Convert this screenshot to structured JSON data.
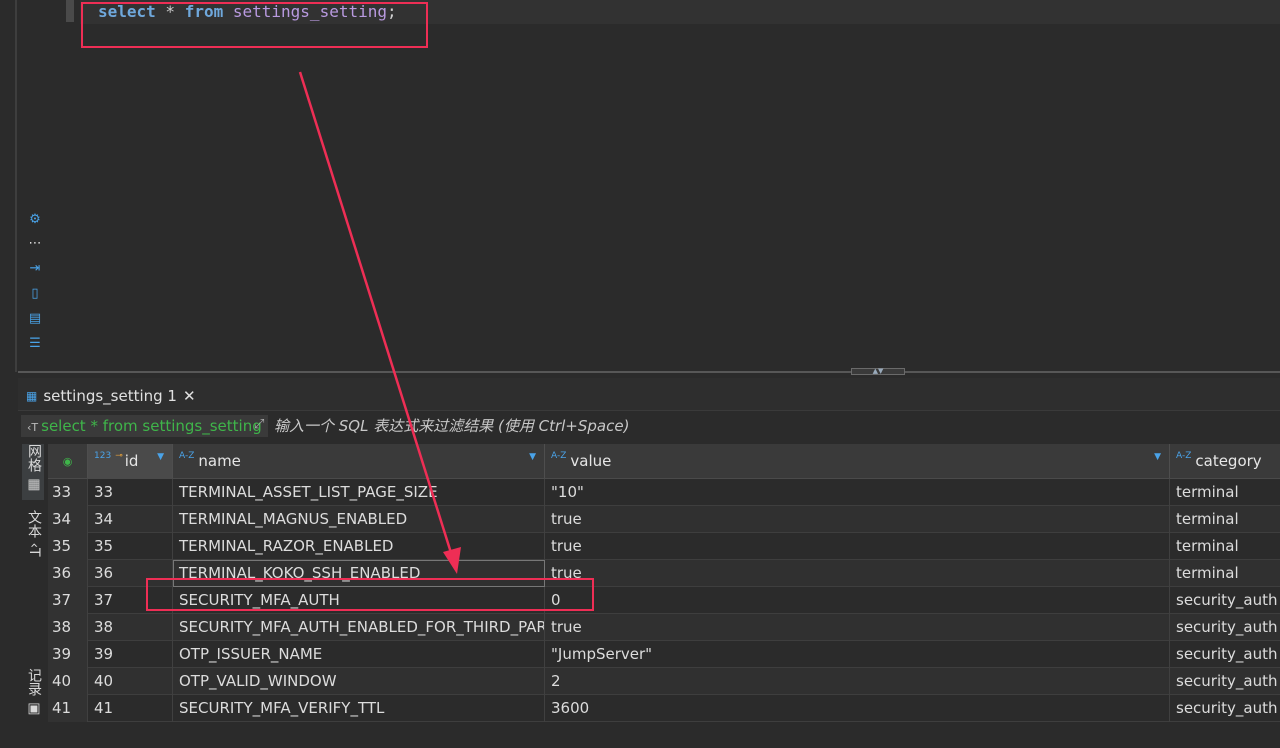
{
  "editor": {
    "query_keyword_select": "select",
    "query_star": " * ",
    "query_keyword_from": "from",
    "query_table": " settings_setting",
    "query_semicolon": ";"
  },
  "results": {
    "tab_label": "settings_setting 1",
    "tab_close": "✕",
    "filter_query": "select * from settings_setting",
    "filter_hint": "输入一个 SQL 表达式来过滤结果 (使用 Ctrl+Space)",
    "side_tabs": {
      "grid": "网格",
      "text": "文本",
      "records": "记录"
    },
    "columns": {
      "id": {
        "type_icon": "123",
        "label": "id"
      },
      "name": {
        "type_icon": "A-Z",
        "label": "name"
      },
      "value": {
        "type_icon": "A-Z",
        "label": "value"
      },
      "category": {
        "type_icon": "A-Z",
        "label": "category"
      }
    },
    "rows": [
      {
        "rn": "33",
        "id": "33",
        "name": "TERMINAL_ASSET_LIST_PAGE_SIZE",
        "value": "\"10\"",
        "category": "terminal"
      },
      {
        "rn": "34",
        "id": "34",
        "name": "TERMINAL_MAGNUS_ENABLED",
        "value": "true",
        "category": "terminal"
      },
      {
        "rn": "35",
        "id": "35",
        "name": "TERMINAL_RAZOR_ENABLED",
        "value": "true",
        "category": "terminal"
      },
      {
        "rn": "36",
        "id": "36",
        "name": "TERMINAL_KOKO_SSH_ENABLED",
        "value": "true",
        "category": "terminal"
      },
      {
        "rn": "37",
        "id": "37",
        "name": "SECURITY_MFA_AUTH",
        "value": "0",
        "category": "security_auth"
      },
      {
        "rn": "38",
        "id": "38",
        "name": "SECURITY_MFA_AUTH_ENABLED_FOR_THIRD_PARTY",
        "value": "true",
        "category": "security_auth"
      },
      {
        "rn": "39",
        "id": "39",
        "name": "OTP_ISSUER_NAME",
        "value": "\"JumpServer\"",
        "category": "security_auth"
      },
      {
        "rn": "40",
        "id": "40",
        "name": "OTP_VALID_WINDOW",
        "value": "2",
        "category": "security_auth"
      },
      {
        "rn": "41",
        "id": "41",
        "name": "SECURITY_MFA_VERIFY_TTL",
        "value": "3600",
        "category": "security_auth"
      }
    ]
  },
  "colors": {
    "annotation": "#ee2e55",
    "keyword": "#6fa8dc",
    "table": "#b99ae0",
    "filter_text": "#3fb54a"
  }
}
